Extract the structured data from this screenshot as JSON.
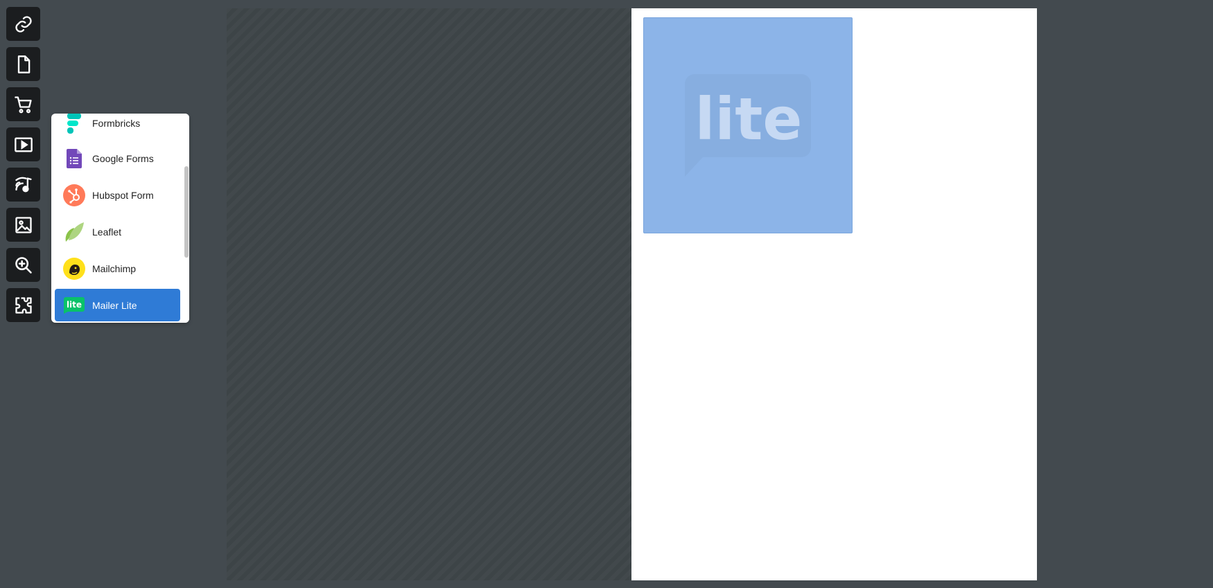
{
  "toolbar": {
    "tools": [
      {
        "name": "link-icon"
      },
      {
        "name": "document-icon"
      },
      {
        "name": "cart-icon"
      },
      {
        "name": "video-play-icon"
      },
      {
        "name": "audio-feed-icon"
      },
      {
        "name": "image-icon"
      },
      {
        "name": "zoom-in-icon"
      },
      {
        "name": "puzzle-icon"
      }
    ]
  },
  "integrations_list": {
    "items": [
      {
        "label": "Formbricks",
        "icon": "formbricks-logo"
      },
      {
        "label": "Google Forms",
        "icon": "google-forms-logo"
      },
      {
        "label": "Hubspot Form",
        "icon": "hubspot-logo"
      },
      {
        "label": "Leaflet",
        "icon": "leaflet-logo"
      },
      {
        "label": "Mailchimp",
        "icon": "mailchimp-logo"
      },
      {
        "label": "Mailer Lite",
        "icon": "mailerlite-logo",
        "selected": true,
        "badge_text": "lite"
      }
    ]
  },
  "preview": {
    "logo_text": "lite",
    "background_color": "#8cb4e8"
  },
  "colors": {
    "selected": "#2f7bd6",
    "toolbar_button": "#1b1d1f",
    "background": "#434a4f"
  }
}
